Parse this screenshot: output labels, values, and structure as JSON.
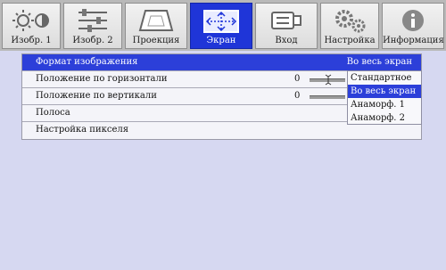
{
  "tabs": [
    {
      "label": "Изобр. 1",
      "icon": "brightness-contrast-icon"
    },
    {
      "label": "Изобр. 2",
      "icon": "sliders-icon"
    },
    {
      "label": "Проекция",
      "icon": "keystone-icon"
    },
    {
      "label": "Экран",
      "icon": "screen-position-icon"
    },
    {
      "label": "Вход",
      "icon": "input-plug-icon"
    },
    {
      "label": "Настройка",
      "icon": "gears-icon"
    },
    {
      "label": "Информация",
      "icon": "info-icon"
    }
  ],
  "menu": {
    "aspect": {
      "label": "Формат изображения",
      "value": "Во весь экран"
    },
    "hpos": {
      "label": "Положение по горизонтали",
      "value": "0"
    },
    "vpos": {
      "label": "Положение по вертикали",
      "value": "0"
    },
    "strip": {
      "label": "Полоса"
    },
    "pixel": {
      "label": "Настройка пикселя"
    }
  },
  "dropdown": {
    "options": [
      "Стандартное",
      "Во весь экран",
      "Анаморф. 1",
      "Анаморф. 2"
    ],
    "selected": "Во весь экран"
  },
  "colors": {
    "active_tab": "#1f35d8",
    "selection": "#2c3fd9",
    "background": "#d6d8f1"
  }
}
